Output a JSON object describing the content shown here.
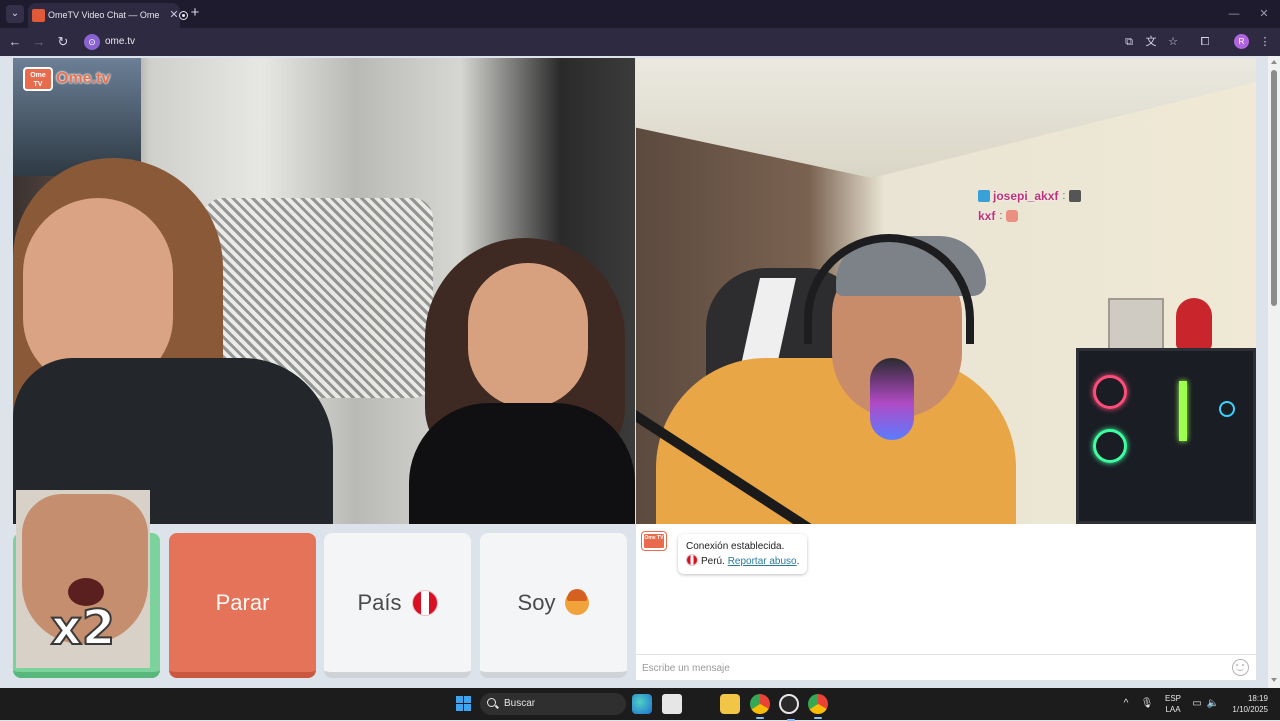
{
  "browser": {
    "tab_title": "OmeTV Video Chat — Ome",
    "url": "ome.tv",
    "profile_initial": "R"
  },
  "site": {
    "logo_badge": "Ome TV",
    "logo_word": "Ome.tv"
  },
  "stream_overlay": {
    "line1_name": "josepi_akxf",
    "line2_name": "kxf",
    "separator": ":"
  },
  "self_cam": {
    "badge": "x2"
  },
  "controls": {
    "stop_label": "Parar",
    "country_label": "País",
    "country_flag": "peru-flag",
    "gender_label": "Soy",
    "gender_icon": "boy-emoji-icon"
  },
  "chat": {
    "logo_badge": "Ome TV",
    "status_message": "Conexión establecida.",
    "country_name": "Perú.",
    "report_link": "Reportar abuso",
    "report_link_suffix": ".",
    "input_placeholder": "Escribe un mensaje"
  },
  "taskbar": {
    "search_label": "Buscar",
    "lang_line1": "ESP",
    "lang_line2": "LAA",
    "time": "18:19",
    "date": "1/10/2025"
  },
  "colors": {
    "accent": "#e5735a",
    "green_button": "#7cd29b",
    "brand": "#e86b4d",
    "link": "#2a7a9c"
  }
}
